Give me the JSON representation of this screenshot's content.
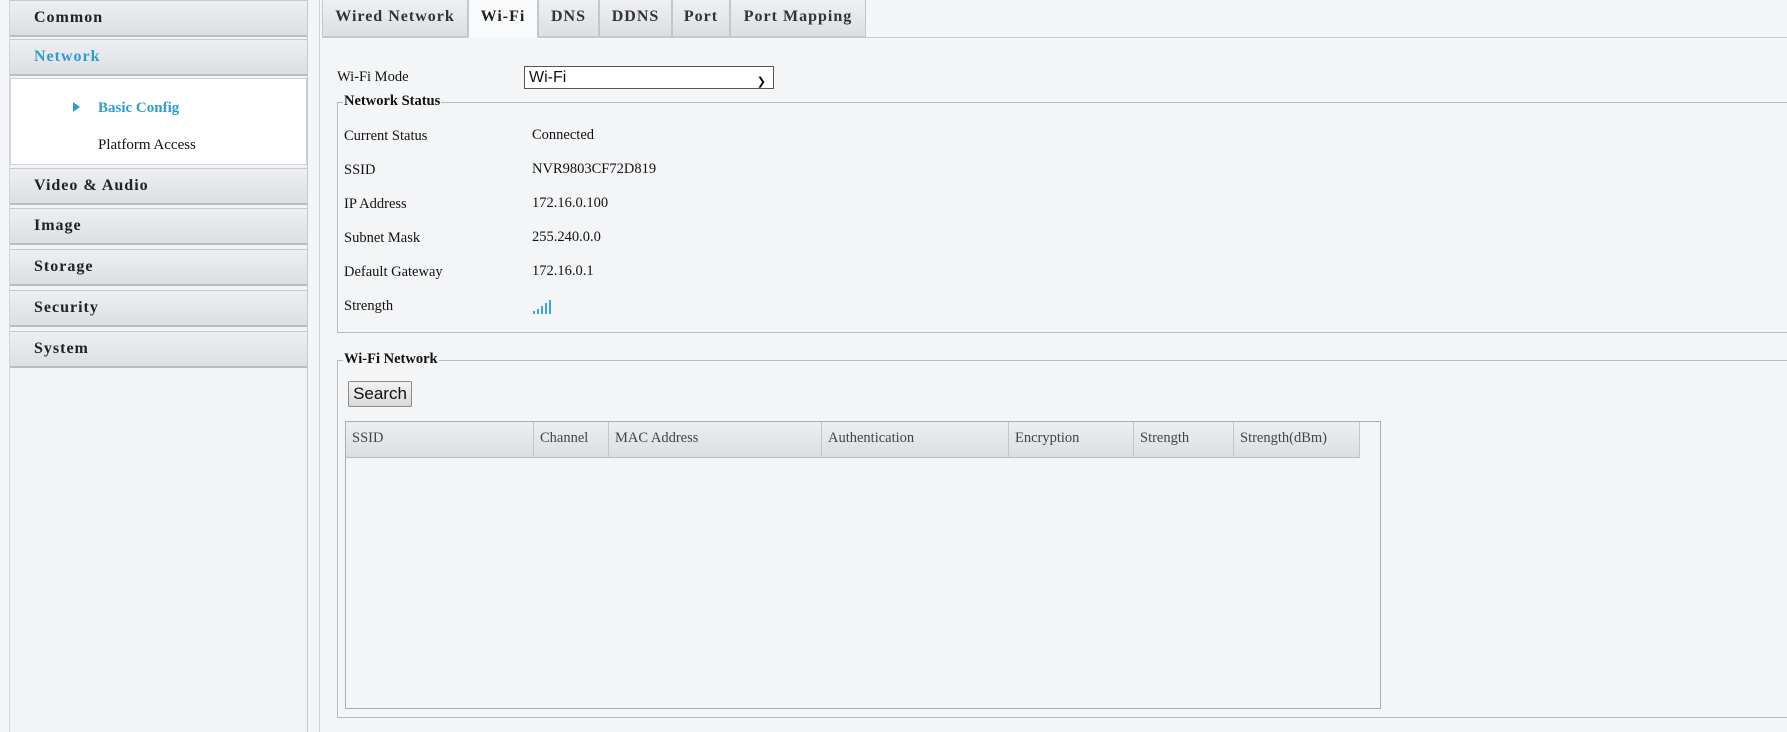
{
  "sidebar": {
    "groups": [
      {
        "label": "Common"
      },
      {
        "label": "Network"
      },
      {
        "label": "Video & Audio"
      },
      {
        "label": "Image"
      },
      {
        "label": "Storage"
      },
      {
        "label": "Security"
      },
      {
        "label": "System"
      }
    ],
    "network_items": [
      {
        "label": "Basic Config"
      },
      {
        "label": "Platform Access"
      }
    ]
  },
  "tabs": [
    {
      "label": "Wired Network"
    },
    {
      "label": "Wi-Fi"
    },
    {
      "label": "DNS"
    },
    {
      "label": "DDNS"
    },
    {
      "label": "Port"
    },
    {
      "label": "Port Mapping"
    }
  ],
  "wifi_mode": {
    "label": "Wi-Fi Mode",
    "value": "Wi-Fi"
  },
  "network_status": {
    "legend": "Network Status",
    "rows": [
      {
        "label": "Current Status",
        "value": "Connected"
      },
      {
        "label": "SSID",
        "value": "NVR9803CF72D819"
      },
      {
        "label": "IP Address",
        "value": "172.16.0.100"
      },
      {
        "label": "Subnet Mask",
        "value": "255.240.0.0"
      },
      {
        "label": "Default Gateway",
        "value": "172.16.0.1"
      },
      {
        "label": "Strength",
        "value": ""
      }
    ],
    "strength_icon": "signal-strength-icon"
  },
  "wifi_network": {
    "legend": "Wi-Fi Network",
    "search_label": "Search",
    "columns": [
      "SSID",
      "Channel",
      "MAC Address",
      "Authentication",
      "Encryption",
      "Strength",
      "Strength(dBm)"
    ],
    "rows": []
  },
  "colors": {
    "accent": "#2f9ccc"
  }
}
